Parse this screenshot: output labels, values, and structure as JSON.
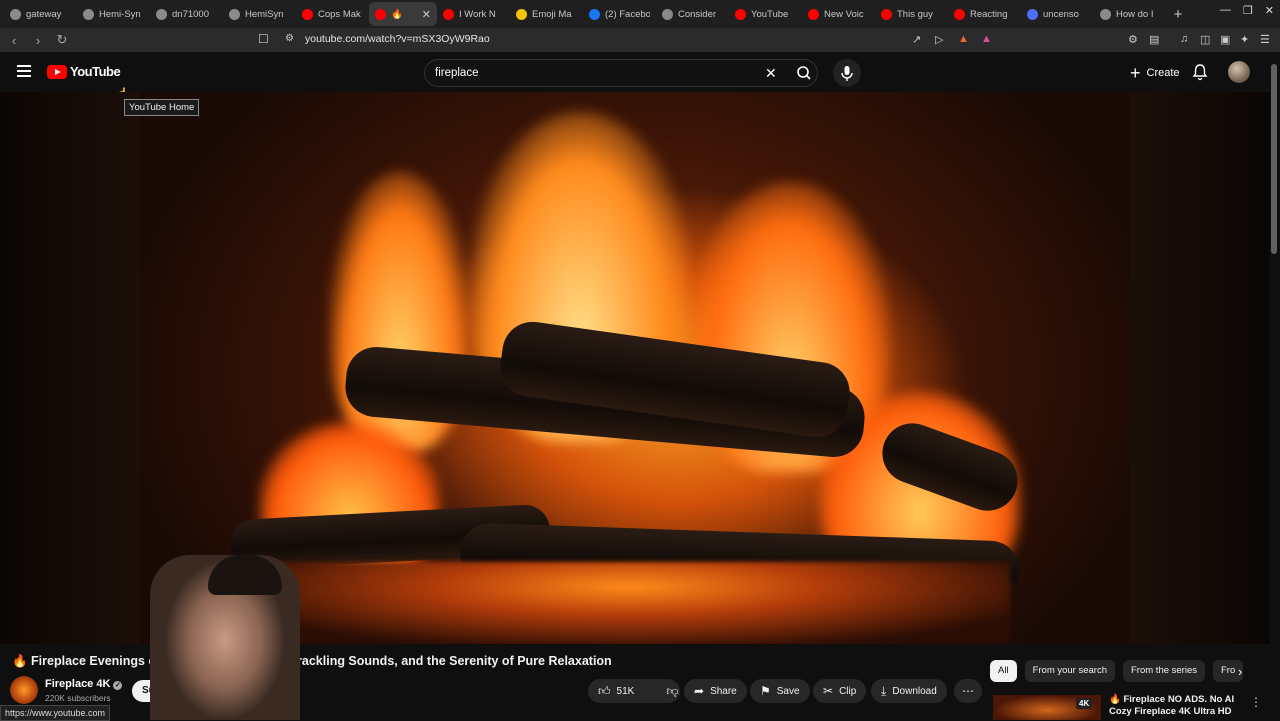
{
  "browser": {
    "tabs": [
      {
        "title": "gateway",
        "color": "#8a8a8a"
      },
      {
        "title": "Hemi-Syn",
        "color": "#8a8a8a"
      },
      {
        "title": "dn71000",
        "color": "#8a8a8a"
      },
      {
        "title": "HemiSyn",
        "color": "#8a8a8a"
      },
      {
        "title": "Cops Mak",
        "color": "#ff0000"
      },
      {
        "title": "🔥",
        "color": "#ff0000",
        "active": true
      },
      {
        "title": "I Work N",
        "color": "#ff0000"
      },
      {
        "title": "Emoji Ma",
        "color": "#f5c400"
      },
      {
        "title": "(2) Facebo",
        "color": "#1877f2"
      },
      {
        "title": "Consider",
        "color": "#8a8a8a"
      },
      {
        "title": "YouTube",
        "color": "#ff0000"
      },
      {
        "title": "New Voic",
        "color": "#ff0000"
      },
      {
        "title": "This guy",
        "color": "#ff0000"
      },
      {
        "title": "Reacting",
        "color": "#ff0000"
      },
      {
        "title": "uncenso",
        "color": "#4c6ef5"
      },
      {
        "title": "How do I",
        "color": "#8a8a8a"
      }
    ],
    "new_tab": "+",
    "url": "youtube.com/watch?v=mSX3OyW9Rao",
    "status_url": "https://www.youtube.com"
  },
  "youtube": {
    "logo_text": "YouTube",
    "tooltip": "YouTube Home",
    "search_value": "fireplace",
    "create_label": "Create",
    "video": {
      "title_part1": "🔥 Fireplace Evenings of",
      "title_part2": "Crackling Sounds, and the Serenity of Pure Relaxation",
      "channel": "Fireplace 4K",
      "subscribers": "220K subscribers",
      "subscribe_label": "Su",
      "likes": "51K",
      "share_label": "Share",
      "save_label": "Save",
      "clip_label": "Clip",
      "download_label": "Download"
    },
    "chips": [
      "All",
      "From your search",
      "From the series",
      "Fro"
    ],
    "recommendation": {
      "badge": "4K",
      "title_line1": "🔥 Fireplace NO ADS. No AI",
      "title_line2": "Cozy Fireplace 4K Ultra HD"
    }
  },
  "colors": {
    "accent": "#ff0000",
    "background": "#0f0f0f"
  }
}
